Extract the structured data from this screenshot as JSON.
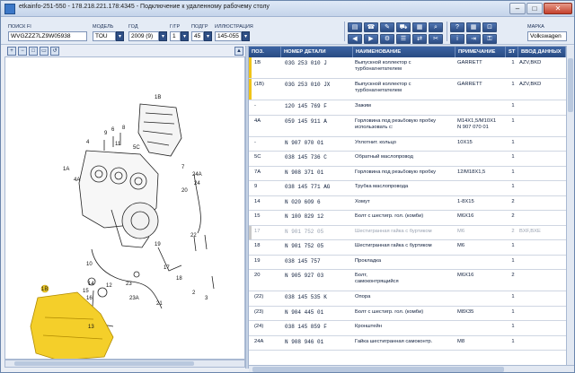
{
  "window": {
    "title": "etkainfo-251-550 - 178.218.221.178:4345 - Подключение к удаленному рабочему столу",
    "minimize": "–",
    "maximize": "□",
    "close": "✕"
  },
  "filters": {
    "search": {
      "label": "ПОИСК FI",
      "value": "WVGZZZ7LZ9W05938"
    },
    "model": {
      "label": "МОДЕЛЬ",
      "value": "TOU"
    },
    "year": {
      "label": "ГОД",
      "value": "2009 (9)"
    },
    "group": {
      "label": "Г/ГР",
      "value": "1"
    },
    "subgroup": {
      "label": "ПОДГР",
      "value": "45"
    },
    "illustration": {
      "label": "ИЛЛЮСТРАЦИЯ",
      "value": "145-055"
    },
    "brand": {
      "label": "МАРКА",
      "value": "Volkswagen"
    },
    "dropdown_glyph": "▾"
  },
  "toolbar_icons": [
    "print-icon",
    "phone-icon",
    "note-icon",
    "car-icon",
    "printer-alt-icon",
    "zoom-icon",
    "back-icon",
    "forward-icon",
    "settings-icon",
    "list-icon",
    "arrows-icon",
    "tools-icon",
    "help-icon",
    "grid-icon",
    "lock-icon",
    "info-icon",
    "exit-icon",
    "key-icon"
  ],
  "left_toolbar": {
    "zoom_in": "+",
    "zoom_out": "−",
    "fit": "□",
    "page": "▭",
    "refresh": "↺",
    "up": "▲"
  },
  "illustration": {
    "callouts": [
      "1A",
      "4A",
      "1B",
      "4",
      "6",
      "8",
      "9",
      "5C",
      "7",
      "11",
      "20",
      "22",
      "24",
      "24A",
      "19",
      "17",
      "18",
      "10",
      "14",
      "15",
      "16",
      "12",
      "23",
      "23A",
      "21",
      "2",
      "3",
      "13"
    ],
    "highlight_callout": "1B"
  },
  "table": {
    "headers": {
      "pos": "ПОЗ.",
      "part_number": "НОМЕР ДЕТАЛИ",
      "name": "НАИМЕНОВАНИЕ",
      "note": "ПРИМЕЧАНИЕ",
      "st": "ST",
      "input": "ВВОД ДАННЫХ"
    },
    "rows": [
      {
        "pos": "1B",
        "pn": "03G 253 010 J",
        "name": "Выпускной коллектор с\nтурбонагнетателем",
        "note": "GARRETT",
        "st": "1",
        "input": "AZV,BKD"
      },
      {
        "pos": "(1B)",
        "pn": "03G 253 010 JX",
        "name": "Выпускной коллектор с\nтурбонагнетателем",
        "note": "GARRETT",
        "st": "1",
        "input": "AZV,BKD"
      },
      {
        "pos": "-",
        "pn": "120 145 769 F",
        "name": "Зажим",
        "note": "",
        "st": "1",
        "input": ""
      },
      {
        "pos": "4A",
        "pn": "059 145 911 A",
        "name": "Горловина под резьбовую пробку\nиспользовать с:",
        "note": "M14X1,5/M10X1\nN  907 070 01",
        "st": "1",
        "input": ""
      },
      {
        "pos": "-",
        "pn": "N   907 070 01",
        "name": "Уплотнит. кольцо",
        "note": "10X15",
        "st": "1",
        "input": ""
      },
      {
        "pos": "5C",
        "pn": "038 145 736 C",
        "name": "Обратный маслопровод",
        "note": "",
        "st": "1",
        "input": ""
      },
      {
        "pos": "7A",
        "pn": "N   908 371 01",
        "name": "Горловина под резьбовую пробку",
        "note": "12/M18X1,5",
        "st": "1",
        "input": ""
      },
      {
        "pos": "9",
        "pn": "038 145 771 AG",
        "name": "Трубка маслопровода",
        "note": "",
        "st": "1",
        "input": ""
      },
      {
        "pos": "14",
        "pn": "N   020 609 6",
        "name": "Хомут",
        "note": "1-8X15",
        "st": "2",
        "input": ""
      },
      {
        "pos": "15",
        "pn": "N   100 829 12",
        "name": "Болт с шестигр. гол. (комби)",
        "note": "M6X16",
        "st": "2",
        "input": ""
      },
      {
        "pos": "17",
        "pn": "N   901 752 05",
        "name": "Шестигранная гайка с буртиком",
        "note": "M6",
        "st": "2",
        "input": "BXF,BXE"
      },
      {
        "pos": "18",
        "pn": "N   901 752 05",
        "name": "Шестигранная гайка с буртиком",
        "note": "M6",
        "st": "1",
        "input": ""
      },
      {
        "pos": "19",
        "pn": "038 145 757",
        "name": "Прокладка",
        "note": "",
        "st": "1",
        "input": ""
      },
      {
        "pos": "20",
        "pn": "N   905 927 03",
        "name": "Болт,\nсамоконтрящийся",
        "note": "M6X16",
        "st": "2",
        "input": ""
      },
      {
        "pos": "(22)",
        "pn": "038 145 535 K",
        "name": "Опора",
        "note": "",
        "st": "1",
        "input": ""
      },
      {
        "pos": "(23)",
        "pn": "N   904 445 01",
        "name": "Болт с шестигр. гол. (комби)",
        "note": "M8X35",
        "st": "1",
        "input": ""
      },
      {
        "pos": "(24)",
        "pn": "038 145 859 F",
        "name": "Кронштейн",
        "note": "",
        "st": "1",
        "input": ""
      },
      {
        "pos": "24A",
        "pn": "N   908 946 01",
        "name": "Гайка шестигранная самоконтр.",
        "note": "M8",
        "st": "1",
        "input": ""
      }
    ]
  }
}
